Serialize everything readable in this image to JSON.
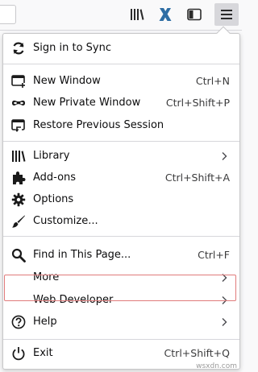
{
  "toolbar": {
    "buttons": [
      {
        "icon": "library-icon"
      },
      {
        "icon": "extension-x-icon",
        "color": "#2e6da4"
      },
      {
        "icon": "sidebar-icon"
      },
      {
        "icon": "hamburger-menu-icon",
        "active": true
      }
    ]
  },
  "menu": {
    "sync": {
      "label": "Sign in to Sync"
    },
    "new_window": {
      "label": "New Window",
      "shortcut": "Ctrl+N"
    },
    "private_window": {
      "label": "New Private Window",
      "shortcut": "Ctrl+Shift+P"
    },
    "restore": {
      "label": "Restore Previous Session"
    },
    "library": {
      "label": "Library"
    },
    "addons": {
      "label": "Add-ons",
      "shortcut": "Ctrl+Shift+A"
    },
    "options": {
      "label": "Options"
    },
    "customize": {
      "label": "Customize..."
    },
    "find": {
      "label": "Find in This Page...",
      "shortcut": "Ctrl+F"
    },
    "more": {
      "label": "More"
    },
    "web_developer": {
      "label": "Web Developer"
    },
    "help": {
      "label": "Help"
    },
    "exit": {
      "label": "Exit",
      "shortcut": "Ctrl+Shift+Q"
    }
  },
  "watermark": "wsxdn.com",
  "colors": {
    "highlight_border": "#e07b7b",
    "x_icon": "#2e6da4"
  }
}
